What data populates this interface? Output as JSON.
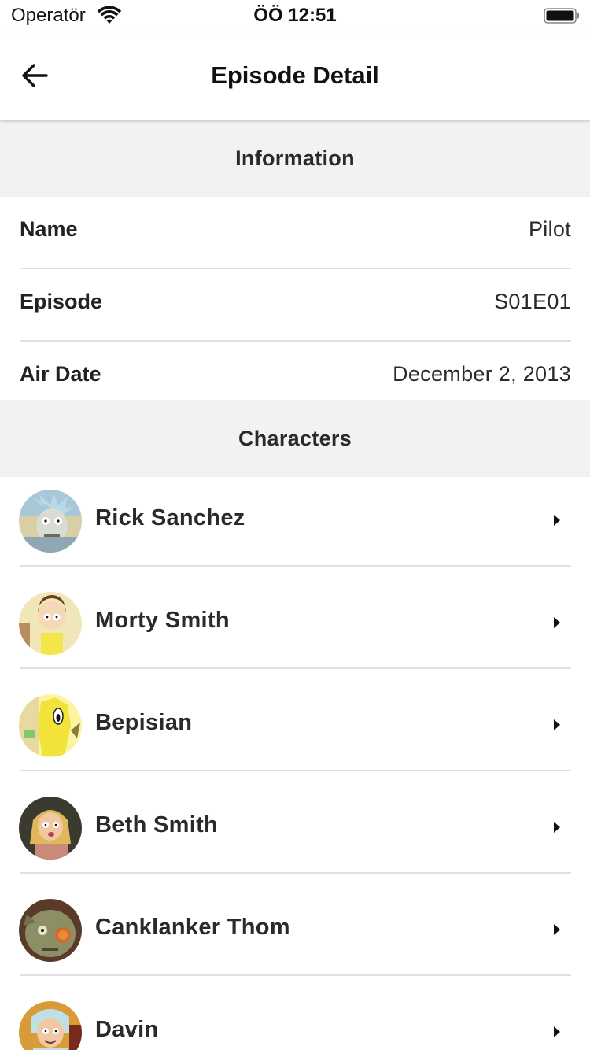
{
  "status_bar": {
    "carrier": "Operatör",
    "time": "ÖÖ 12:51",
    "wifi_icon": "wifi-icon",
    "battery_icon": "battery-icon"
  },
  "nav": {
    "title": "Episode Detail",
    "back_icon": "arrow-left-icon"
  },
  "information": {
    "header": "Information",
    "rows": [
      {
        "label": "Name",
        "value": "Pilot"
      },
      {
        "label": "Episode",
        "value": "S01E01"
      },
      {
        "label": "Air Date",
        "value": "December 2, 2013"
      }
    ]
  },
  "characters": {
    "header": "Characters",
    "items": [
      {
        "name": "Rick Sanchez",
        "avatar_colors": [
          "#a8c8d8",
          "#8fa7b3"
        ]
      },
      {
        "name": "Morty Smith",
        "avatar_colors": [
          "#f1e6b8",
          "#f4e54a"
        ]
      },
      {
        "name": "Bepisian",
        "avatar_colors": [
          "#fbf4a0",
          "#f2e33a"
        ]
      },
      {
        "name": "Beth Smith",
        "avatar_colors": [
          "#3b3a2e",
          "#e8c58a"
        ]
      },
      {
        "name": "Canklanker Thom",
        "avatar_colors": [
          "#5a3b2a",
          "#8c8f64"
        ]
      },
      {
        "name": "Davin",
        "avatar_colors": [
          "#d99a3a",
          "#bfe0e6"
        ]
      }
    ],
    "chevron_icon": "chevron-right-icon"
  }
}
